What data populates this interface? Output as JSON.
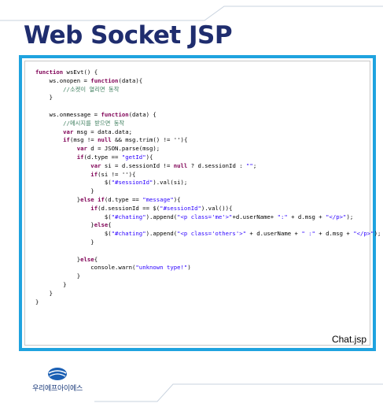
{
  "slide": {
    "title": "Web Socket JSP",
    "file_label": "Chat.jsp",
    "company": "우리에프아이에스"
  },
  "colors": {
    "title": "#1f2d6e",
    "frame_border": "#1fa3df",
    "keyword": "#7f0055",
    "string": "#2a00ff",
    "comment": "#3f7f5f",
    "logo": "#1a5fb4"
  },
  "code_lines": [
    [
      [
        "kw",
        "function"
      ],
      [
        "t",
        " wsEvt() {"
      ]
    ],
    [
      [
        "t",
        "    ws.onopen = "
      ],
      [
        "kw",
        "function"
      ],
      [
        "t",
        "(data){"
      ]
    ],
    [
      [
        "t",
        "        "
      ],
      [
        "cm",
        "//소켓이 열리면 동작"
      ]
    ],
    [
      [
        "t",
        "    }"
      ]
    ],
    [
      [
        "t",
        ""
      ]
    ],
    [
      [
        "t",
        "    ws.onmessage = "
      ],
      [
        "kw",
        "function"
      ],
      [
        "t",
        "(data) {"
      ]
    ],
    [
      [
        "t",
        "        "
      ],
      [
        "cm",
        "//메시지를 받으면 동작"
      ]
    ],
    [
      [
        "t",
        "        "
      ],
      [
        "kw",
        "var"
      ],
      [
        "t",
        " msg = data.data;"
      ]
    ],
    [
      [
        "t",
        "        "
      ],
      [
        "kw",
        "if"
      ],
      [
        "t",
        "(msg != "
      ],
      [
        "kw",
        "null"
      ],
      [
        "t",
        " && msg.trim() != ''){"
      ]
    ],
    [
      [
        "t",
        "            "
      ],
      [
        "kw",
        "var"
      ],
      [
        "t",
        " d = JSON.parse(msg);"
      ]
    ],
    [
      [
        "t",
        "            "
      ],
      [
        "kw",
        "if"
      ],
      [
        "t",
        "(d.type == "
      ],
      [
        "str",
        "\"getId\""
      ],
      [
        "t",
        "){"
      ]
    ],
    [
      [
        "t",
        "                "
      ],
      [
        "kw",
        "var"
      ],
      [
        "t",
        " si = d.sessionId != "
      ],
      [
        "kw",
        "null"
      ],
      [
        "t",
        " ? d.sessionId : "
      ],
      [
        "str",
        "\"\""
      ],
      [
        "t",
        ";"
      ]
    ],
    [
      [
        "t",
        "                "
      ],
      [
        "kw",
        "if"
      ],
      [
        "t",
        "(si != ''){"
      ]
    ],
    [
      [
        "t",
        "                    $("
      ],
      [
        "str",
        "\"#sessionId\""
      ],
      [
        "t",
        ").val(si);"
      ]
    ],
    [
      [
        "t",
        "                }"
      ]
    ],
    [
      [
        "t",
        "            }"
      ],
      [
        "kw",
        "else if"
      ],
      [
        "t",
        "(d.type == "
      ],
      [
        "str",
        "\"message\""
      ],
      [
        "t",
        "){"
      ]
    ],
    [
      [
        "t",
        "                "
      ],
      [
        "kw",
        "if"
      ],
      [
        "t",
        "(d.sessionId == $("
      ],
      [
        "str",
        "\"#sessionId\""
      ],
      [
        "t",
        ").val()){"
      ]
    ],
    [
      [
        "t",
        "                    $("
      ],
      [
        "str",
        "\"#chating\""
      ],
      [
        "t",
        ").append("
      ],
      [
        "str",
        "\"<p class='me'>\""
      ],
      [
        "t",
        "+d.userName+ "
      ],
      [
        "str",
        "\":\""
      ],
      [
        "t",
        " + d.msg + "
      ],
      [
        "str",
        "\"</p>\""
      ],
      [
        "t",
        ");"
      ]
    ],
    [
      [
        "t",
        "                }"
      ],
      [
        "kw",
        "else"
      ],
      [
        "t",
        "{"
      ]
    ],
    [
      [
        "t",
        "                    $("
      ],
      [
        "str",
        "\"#chating\""
      ],
      [
        "t",
        ").append("
      ],
      [
        "str",
        "\"<p class='others'>\""
      ],
      [
        "t",
        " + d.userName + "
      ],
      [
        "str",
        "\" :\""
      ],
      [
        "t",
        " + d.msg + "
      ],
      [
        "str",
        "\"</p>\""
      ],
      [
        "t",
        ");"
      ]
    ],
    [
      [
        "t",
        "                }"
      ]
    ],
    [
      [
        "t",
        ""
      ]
    ],
    [
      [
        "t",
        "            }"
      ],
      [
        "kw",
        "else"
      ],
      [
        "t",
        "{"
      ]
    ],
    [
      [
        "t",
        "                console.warn("
      ],
      [
        "str",
        "\"unknown type!\""
      ],
      [
        "t",
        ")"
      ]
    ],
    [
      [
        "t",
        "            }"
      ]
    ],
    [
      [
        "t",
        "        }"
      ]
    ],
    [
      [
        "t",
        "    }"
      ]
    ],
    [
      [
        "t",
        "}"
      ]
    ]
  ]
}
